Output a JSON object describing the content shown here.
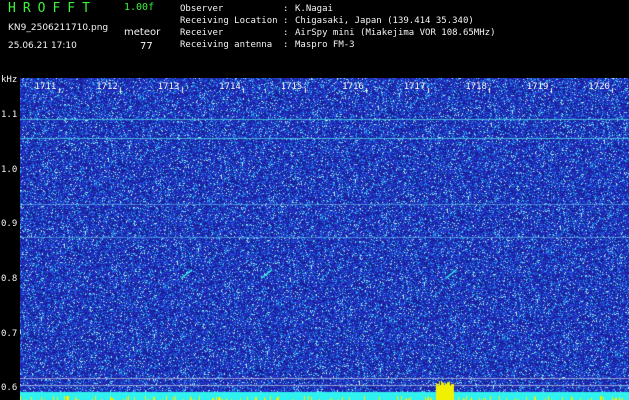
{
  "header": {
    "brand": "HROFFT",
    "version": "1.00f",
    "filename": "KN9_2506211710.png",
    "meteor_label": "meteor",
    "datetime": "25.06.21 17:10",
    "meteor_count": "77"
  },
  "metadata": [
    {
      "key": "Observer",
      "value": "K.Nagai"
    },
    {
      "key": "Receiving Location",
      "value": "Chigasaki, Japan (139.414 35.340)"
    },
    {
      "key": "Receiver",
      "value": "AirSpy mini (Miakejima VOR 108.65MHz)"
    },
    {
      "key": "Receiving antenna",
      "value": "Maspro FM-3"
    }
  ],
  "colors": {
    "background": "#000000",
    "header_green": "#3cf23c",
    "spectrogram_base": "#2a2ec8",
    "signal_cyan": "#30f0f0",
    "signal_yellow": "#f0f000"
  },
  "chart_data": {
    "type": "heatmap",
    "y_unit": "kHz",
    "yticks": [
      "1.1",
      "1.0",
      "0.9",
      "0.8",
      "0.7",
      "0.6"
    ],
    "xticks": [
      "1711",
      "1712",
      "1713",
      "1714",
      "1715",
      "1716",
      "1717",
      "1718",
      "1719",
      "1720"
    ],
    "ylim": [
      0.58,
      1.17
    ],
    "xlim": [
      1710.6,
      1720.5
    ],
    "carrier_lines_khz": [
      1.095,
      1.06,
      0.94,
      0.878,
      0.62,
      0.607
    ],
    "meteor_echoes": [
      {
        "t": 1713.3,
        "khz": 0.81
      },
      {
        "t": 1714.6,
        "khz": 0.81
      },
      {
        "t": 1717.6,
        "khz": 0.81
      }
    ]
  }
}
